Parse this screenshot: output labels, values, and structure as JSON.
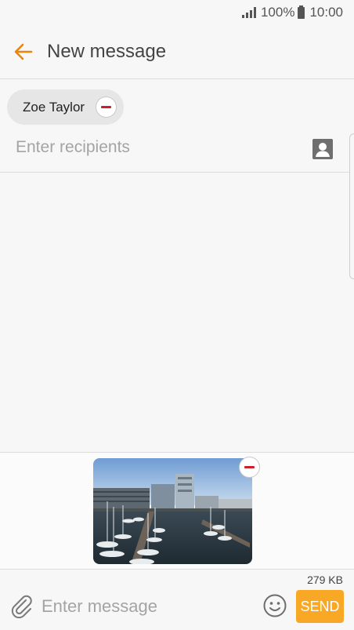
{
  "status_bar": {
    "battery": "100%",
    "time": "10:00"
  },
  "app_bar": {
    "title": "New message"
  },
  "recipients": {
    "chips": [
      {
        "name": "Zoe Taylor"
      }
    ],
    "input_placeholder": "Enter recipients"
  },
  "attachment": {
    "size": "279 KB"
  },
  "compose": {
    "placeholder": "Enter message",
    "send_label": "SEND"
  },
  "colors": {
    "accent": "#f9a825",
    "back_arrow": "#e8860e",
    "remove": "#cc1f2e"
  }
}
